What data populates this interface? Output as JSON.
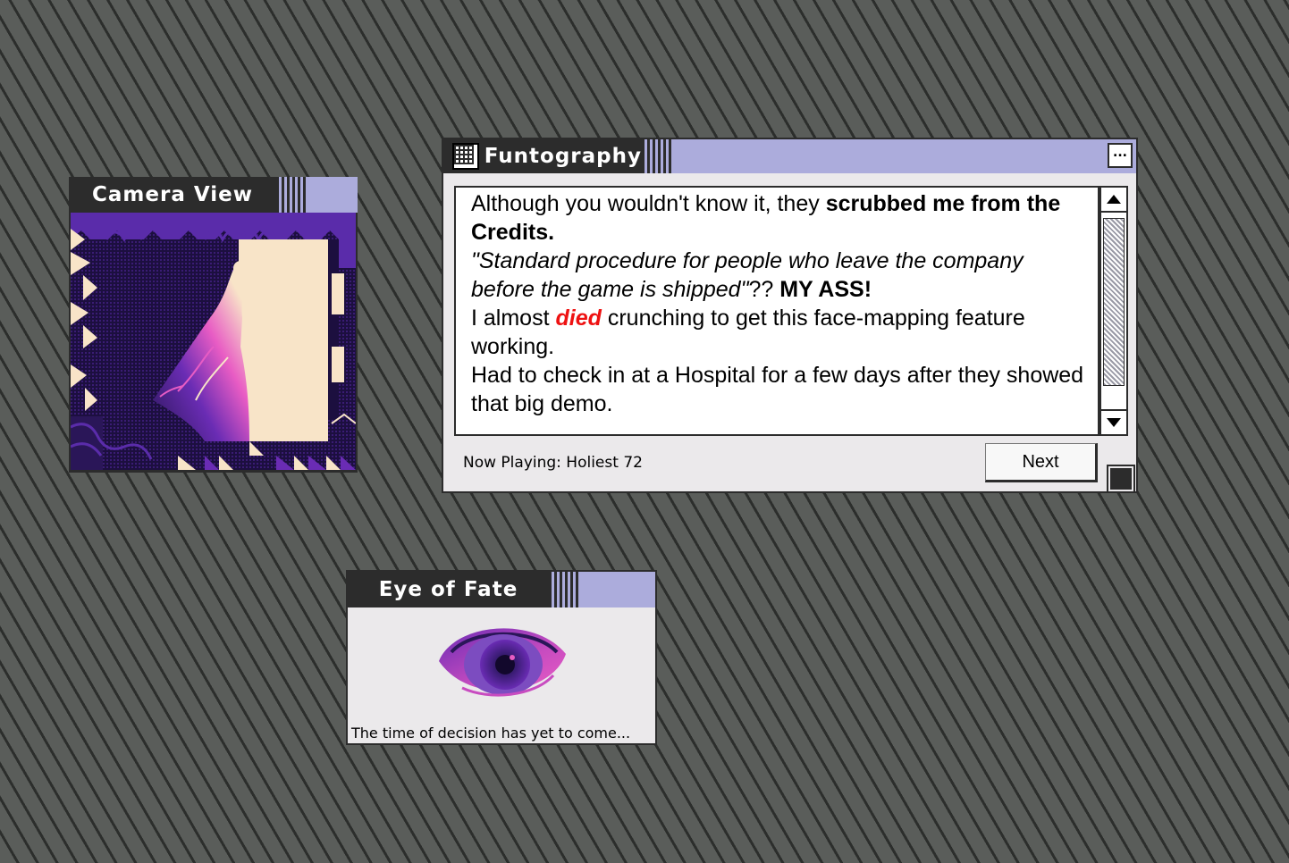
{
  "windows": {
    "camera": {
      "title": "Camera View"
    },
    "funtography": {
      "title": "Funtography",
      "message": {
        "line1_normal": "Although you wouldn't know it, they ",
        "line1_bold": "scrubbed me from the Credits.",
        "line2_italic": "\"Standard procedure for people who leave the company before the game is shipped\"",
        "line2_normal": "?? ",
        "line2_bold": "MY ASS!",
        "line3_pre": "I almost ",
        "line3_red": "died",
        "line3_post": " crunching to get this face-mapping feature working.",
        "line4": "Had to check in at a Hospital for a few days after they showed that big demo."
      },
      "now_playing": "Now Playing: Holiest 72",
      "next_label": "Next",
      "close_glyph": "..."
    },
    "eye": {
      "title": "Eye of Fate",
      "caption": "The time of decision has yet to come..."
    }
  },
  "colors": {
    "accent_lavender": "#acacdc",
    "title_dark": "#2c2c2c",
    "emphasis_red": "#ee1111",
    "camera_purple": "#6a2cb4",
    "camera_pink": "#e85cc4",
    "camera_cream": "#f8e4c8"
  },
  "icons": [
    "menu-grid-icon",
    "close-icon",
    "scroll-up-icon",
    "scroll-down-icon",
    "resize-icon"
  ]
}
